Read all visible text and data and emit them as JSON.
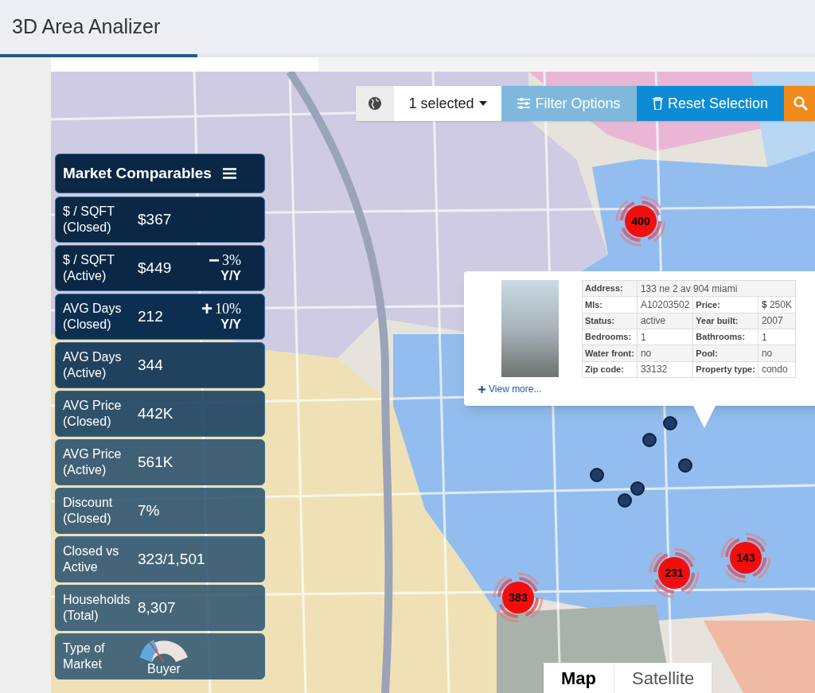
{
  "app": {
    "title": "3D Area Analizer"
  },
  "toolbar": {
    "selection": "1 selected",
    "filter": {
      "label": "Filter Options",
      "disabled": true
    },
    "reset": "Reset Selection"
  },
  "market": {
    "title": "Market Comparables",
    "rows": [
      {
        "kind": "stat",
        "label": "$ / SQFT",
        "sub": "(Closed)",
        "value": "$367"
      },
      {
        "kind": "stat",
        "label": "$ / SQFT",
        "sub": "(Active)",
        "value": "$449",
        "sign": "−",
        "change": "3%",
        "period": "Y/Y"
      },
      {
        "kind": "stat",
        "label": "AVG Days",
        "sub": "(Closed)",
        "value": "212",
        "sign": "+",
        "change": "10%",
        "period": "Y/Y"
      },
      {
        "kind": "stat",
        "label": "AVG Days",
        "sub": "(Active)",
        "value": "344"
      },
      {
        "kind": "stat",
        "label": "AVG Price",
        "sub": "(Closed)",
        "value": "442K"
      },
      {
        "kind": "stat",
        "label": "AVG Price",
        "sub": "(Active)",
        "value": "561K"
      },
      {
        "kind": "stat",
        "label": "Discount",
        "sub": "(Closed)",
        "value": "7%"
      },
      {
        "kind": "stat",
        "label": "Closed vs",
        "sub": "Active",
        "value": "323/1,501"
      },
      {
        "kind": "stat",
        "label": "Households",
        "sub": "(Total)",
        "value": "8,307"
      },
      {
        "kind": "gauge",
        "label": "Type of",
        "sub": "Market",
        "value": "Buyer",
        "level": 0.3
      }
    ]
  },
  "popup": {
    "link": "View more...",
    "rows": [
      [
        {
          "label": "Address:",
          "value": "133 ne 2 av 904 miami"
        }
      ],
      [
        {
          "label": "Mls:",
          "value": "A10203502"
        },
        {
          "label": "Price:",
          "value": "**$** 250K"
        }
      ],
      [
        {
          "label": "Status:",
          "value": "active"
        },
        {
          "label": "Year built:",
          "value": "2007"
        }
      ],
      [
        {
          "label": "Bedrooms:",
          "value": "1"
        },
        {
          "label": "Bathrooms:",
          "value": "1"
        }
      ],
      [
        {
          "label": "Water front:",
          "value": "no"
        },
        {
          "label": "Pool:",
          "value": "no"
        }
      ],
      [
        {
          "label": "Zip code:",
          "value": "33132"
        },
        {
          "label": "Property type:",
          "value": "condo"
        }
      ]
    ]
  },
  "clusters": [
    {
      "count": "400"
    },
    {
      "count": "383"
    },
    {
      "count": "231"
    },
    {
      "count": "143"
    }
  ],
  "map_types": [
    {
      "label": "Map",
      "selected": true
    },
    {
      "label": "Satellite",
      "selected": false
    }
  ]
}
